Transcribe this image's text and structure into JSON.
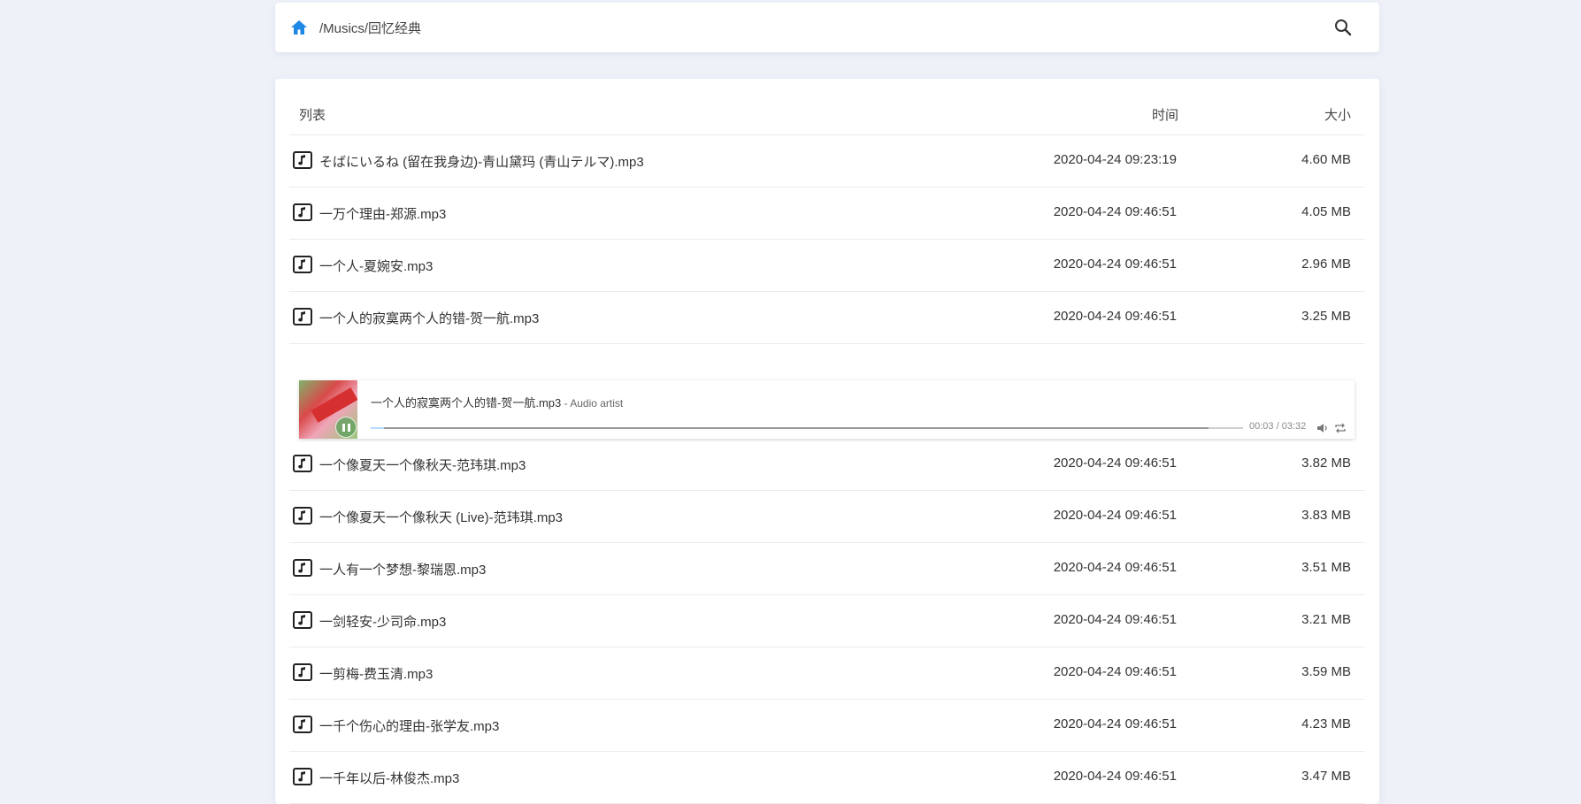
{
  "colors": {
    "accent": "#1e88e5",
    "background": "#eef1f8"
  },
  "header": {
    "path": "/Musics/回忆经典"
  },
  "list": {
    "columns": {
      "name": "列表",
      "time": "时间",
      "size": "大小"
    },
    "rows_before": [
      {
        "name": "そばにいるね (留在我身边)-青山黛玛 (青山テルマ).mp3",
        "time": "2020-04-24 09:23:19",
        "size": "4.60 MB"
      },
      {
        "name": "一万个理由-郑源.mp3",
        "time": "2020-04-24 09:46:51",
        "size": "4.05 MB"
      },
      {
        "name": "一个人-夏婉安.mp3",
        "time": "2020-04-24 09:46:51",
        "size": "2.96 MB"
      },
      {
        "name": "一个人的寂寞两个人的错-贺一航.mp3",
        "time": "2020-04-24 09:46:51",
        "size": "3.25 MB"
      }
    ],
    "rows_after": [
      {
        "name": "一个像夏天一个像秋天-范玮琪.mp3",
        "time": "2020-04-24 09:46:51",
        "size": "3.82 MB"
      },
      {
        "name": "一个像夏天一个像秋天 (Live)-范玮琪.mp3",
        "time": "2020-04-24 09:46:51",
        "size": "3.83 MB"
      },
      {
        "name": "一人有一个梦想-黎瑞恩.mp3",
        "time": "2020-04-24 09:46:51",
        "size": "3.51 MB"
      },
      {
        "name": "一剑轻安-少司命.mp3",
        "time": "2020-04-24 09:46:51",
        "size": "3.21 MB"
      },
      {
        "name": "一剪梅-费玉清.mp3",
        "time": "2020-04-24 09:46:51",
        "size": "3.59 MB"
      },
      {
        "name": "一千个伤心的理由-张学友.mp3",
        "time": "2020-04-24 09:46:51",
        "size": "4.23 MB"
      },
      {
        "name": "一千年以后-林俊杰.mp3",
        "time": "2020-04-24 09:46:51",
        "size": "3.47 MB"
      }
    ]
  },
  "player": {
    "title": "一个人的寂寞两个人的错-贺一航.mp3",
    "artist": " - Audio artist",
    "timer": "00:03 / 03:32",
    "played_fraction": 0.015,
    "loaded_fraction": 0.96
  }
}
